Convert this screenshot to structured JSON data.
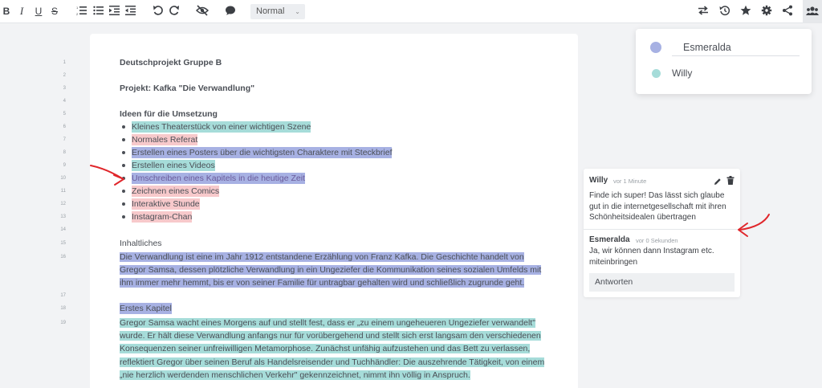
{
  "toolbar": {
    "bold": "B",
    "italic": "I",
    "underline": "U",
    "strike": "S",
    "style_value": "Normal",
    "icons": [
      "bold-icon",
      "italic-icon",
      "underline-icon",
      "strikethrough-icon",
      "ordered-list-icon",
      "bullet-list-icon",
      "indent-icon",
      "outdent-icon",
      "undo-icon",
      "redo-icon",
      "eye-off-icon",
      "comment-icon",
      "swap-icon",
      "history-icon",
      "star-icon",
      "settings-gear-icon",
      "share-icon",
      "users-icon"
    ]
  },
  "doc": {
    "lines": [
      {
        "n": "1",
        "text": "Deutschprojekt Gruppe B"
      },
      {
        "n": "2",
        "text": ""
      },
      {
        "n": "3",
        "text": "Projekt: Kafka \"Die Verwandlung\""
      },
      {
        "n": "4",
        "text": ""
      },
      {
        "n": "5",
        "text": "Ideen für die Umsetzung"
      },
      {
        "n": "6",
        "text": "Kleines Theaterstück von einer wichtigen Szene"
      },
      {
        "n": "7",
        "text": "Normales Referat"
      },
      {
        "n": "8",
        "text": "Erstellen eines Posters über die wichtigsten Charaktere mit Steckbrief"
      },
      {
        "n": "9",
        "text": "Erstellen eines Videos"
      },
      {
        "n": "10",
        "text": "Umschreiben eines Kapitels in die heutige Zeit"
      },
      {
        "n": "11",
        "text": "Zeichnen eines Comics"
      },
      {
        "n": "12",
        "text": "Interaktive Stunde"
      },
      {
        "n": "13",
        "text": "Instagram-Chan"
      },
      {
        "n": "14",
        "text": ""
      },
      {
        "n": "15",
        "text": "Inhaltliches"
      },
      {
        "n": "16",
        "text": "Die Verwandlung ist eine im Jahr 1912 entstandene Erzählung von Franz Kafka. Die Geschichte handelt von Gregor Samsa, dessen plötzliche Verwandlung in ein Ungeziefer die Kommunikation seines sozialen Umfelds mit ihm immer mehr hemmt, bis er von seiner Familie für untragbar gehalten wird und schließlich zugrunde geht."
      },
      {
        "n": "17",
        "text": ""
      },
      {
        "n": "18",
        "text": "Erstes Kapitel"
      },
      {
        "n": "19",
        "text": "Gregor Samsa wacht eines Morgens auf und stellt fest, dass er „zu einem ungeheueren Ungeziefer verwandelt\" wurde. Er hält diese Verwandlung anfangs nur für vorübergehend und stellt sich erst langsam den verschiedenen Konsequenzen seiner unfreiwilligen Metamorphose. Zunächst unfähig aufzustehen und das Bett zu verlassen, reflektiert Gregor über seinen Beruf als Handelsreisender und Tuchhändler: Die auszehrende Tätigkeit, von einem „nie herzlich werdenden menschlichen Verkehr\" gekennzeichnet, nimmt ihn völlig in Anspruch."
      }
    ]
  },
  "users": {
    "list": [
      {
        "name": "Esmeralda",
        "color": "#a7b1e3"
      },
      {
        "name": "Willy",
        "color": "#a6dcd9"
      }
    ]
  },
  "comments": {
    "thread": [
      {
        "author": "Willy",
        "time": "vor 1 Minute",
        "text": "Finde ich super! Das lässt sich glaube gut in die internetgesellschaft mit ihren Schönheitsidealen übertragen"
      },
      {
        "author": "Esmeralda",
        "time": "vor 0 Sekunden",
        "text": "Ja, wir können dann Instagram etc. miteinbringen"
      }
    ],
    "reply_label": "Antworten"
  },
  "colors": {
    "highlight_teal": "#a6dcd9",
    "highlight_pink": "#f7c9cb",
    "highlight_blue": "#a7b1e3",
    "annotation_arrow": "#e0262b"
  }
}
